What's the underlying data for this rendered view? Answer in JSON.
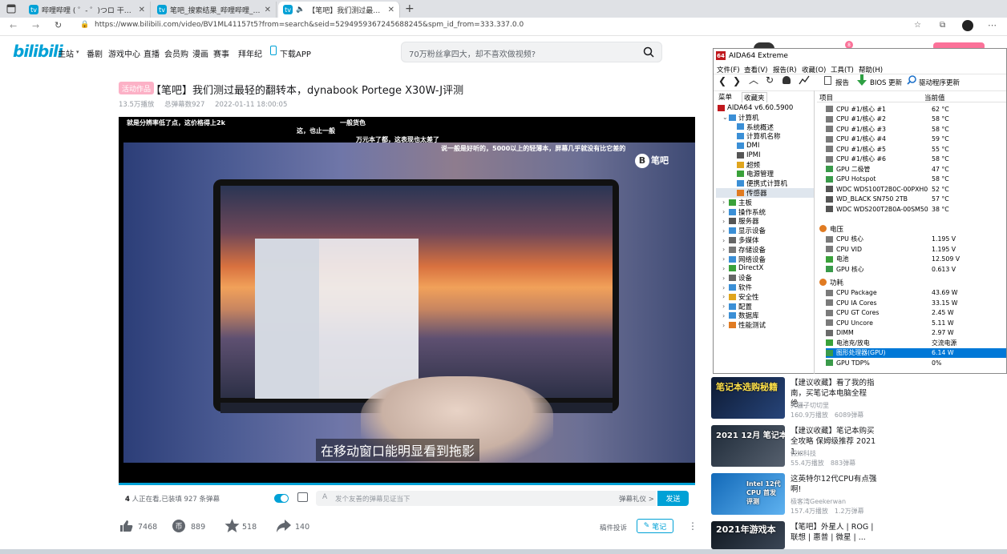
{
  "browser": {
    "tabs": [
      {
        "label": "哔哩哔哩 ( ゜- ゜)つロ 干杯~-bilil",
        "active": false
      },
      {
        "label": "笔吧_搜索结果_哔哩哔哩_Bilibili",
        "active": false
      },
      {
        "label": "【笔吧】我们测过最轻的翻",
        "active": true
      }
    ],
    "new_tab": "+",
    "url": "https://www.bilibili.com/video/BV1ML41157t5?from=search&seid=5294959367245688245&spm_id_from=333.337.0.0"
  },
  "bili_header": {
    "logo": "bilibili",
    "nav": [
      "主站",
      "番剧",
      "游戏中心",
      "直播",
      "会员购",
      "漫画",
      "赛事",
      "拜年纪",
      "下载APP"
    ],
    "search_placeholder": "70万粉丝拿四大，却不喜欢做视频?",
    "login_badge": "8"
  },
  "video": {
    "tag": "活动作品",
    "title": "【笔吧】我们测过最轻的翻转本，dynabook Portege X30W-J评测",
    "plays": "13.5万播放",
    "danmaku_total": "总弹幕数927",
    "date": "2022-01-11 18:00:05",
    "overlay_texts": [
      "就是分辨率低了点，这价格得上2k",
      "一般货色",
      "这，也止一般",
      "万元本了都，这表现也太差了",
      "说一般是好听的，5000以上的轻薄本，屏幕几乎就没有比它差的"
    ],
    "watermark": "笔吧",
    "subtitle": "在移动窗口能明显看到拖影"
  },
  "danmaku_bar": {
    "viewers_count": "4",
    "viewers_text": "人正在看,已装填 927 条弹幕",
    "input_placeholder": "发个友善的弹幕见证当下",
    "etiquette": "弹幕礼仪 >",
    "send": "发送"
  },
  "actions": {
    "like": "7468",
    "coin": "889",
    "favorite": "518",
    "share": "140",
    "complain": "稿件投诉",
    "note": "笔记"
  },
  "recommendations": [
    {
      "title": "【建议收藏】看了我的指南，买笔记本电脑全程绝...",
      "owner": "大疆子切切里",
      "plays": "160.9万播放",
      "danmaku": "6089弹幕",
      "thumb_text": "笔记本选购秘籍"
    },
    {
      "title": "【建议收藏】笔记本购买全攻略 保姆级推荐 2021 1...",
      "owner": "假如科技",
      "plays": "55.4万播放",
      "danmaku": "883弹幕",
      "thumb_text": "2021 12月 笔记本推荐"
    },
    {
      "title": "这英特尔12代CPU有点强啊!",
      "owner": "极客湾Geekerwan",
      "plays": "157.4万播放",
      "danmaku": "1.2万弹幕",
      "thumb_text": "Intel 12代CPU 首发评测"
    },
    {
      "title": "【笔吧】外星人 | ROG | 联想 | 惠普 | 微星 | ...",
      "owner": "",
      "plays": "",
      "danmaku": "",
      "thumb_text": "2021年游戏本"
    }
  ],
  "aida": {
    "title": "AIDA64 Extreme",
    "logo": "64",
    "menu": [
      "文件(F)",
      "查看(V)",
      "报告(R)",
      "收藏(O)",
      "工具(T)",
      "帮助(H)"
    ],
    "toolbar": {
      "report": "报告",
      "bios": "BIOS 更新",
      "driver": "驱动程序更新"
    },
    "pane_tabs": [
      "菜单",
      "收藏夹"
    ],
    "tree": [
      {
        "label": "AIDA64 v6.60.5900",
        "level": 0,
        "icon": "#c0181d"
      },
      {
        "label": "计算机",
        "level": 1,
        "icon": "#3b8fd6",
        "open": true
      },
      {
        "label": "系统概述",
        "level": 2,
        "icon": "#3b8fd6"
      },
      {
        "label": "计算机名称",
        "level": 2,
        "icon": "#3b8fd6"
      },
      {
        "label": "DMI",
        "level": 2,
        "icon": "#3b8fd6"
      },
      {
        "label": "IPMI",
        "level": 2,
        "icon": "#555555"
      },
      {
        "label": "超频",
        "level": 2,
        "icon": "#e0a51e"
      },
      {
        "label": "电源管理",
        "level": 2,
        "icon": "#3aa13a"
      },
      {
        "label": "便携式计算机",
        "level": 2,
        "icon": "#3b8fd6"
      },
      {
        "label": "传感器",
        "level": 2,
        "icon": "#e07b22",
        "selected": true
      },
      {
        "label": "主板",
        "level": 1,
        "icon": "#3aa13a"
      },
      {
        "label": "操作系统",
        "level": 1,
        "icon": "#3b8fd6"
      },
      {
        "label": "服务器",
        "level": 1,
        "icon": "#555555"
      },
      {
        "label": "显示设备",
        "level": 1,
        "icon": "#3b8fd6"
      },
      {
        "label": "多媒体",
        "level": 1,
        "icon": "#666666"
      },
      {
        "label": "存储设备",
        "level": 1,
        "icon": "#777777"
      },
      {
        "label": "网络设备",
        "level": 1,
        "icon": "#3b8fd6"
      },
      {
        "label": "DirectX",
        "level": 1,
        "icon": "#3aa13a"
      },
      {
        "label": "设备",
        "level": 1,
        "icon": "#666666"
      },
      {
        "label": "软件",
        "level": 1,
        "icon": "#3b8fd6"
      },
      {
        "label": "安全性",
        "level": 1,
        "icon": "#e0a51e"
      },
      {
        "label": "配置",
        "level": 1,
        "icon": "#3b8fd6"
      },
      {
        "label": "数据库",
        "level": 1,
        "icon": "#3b8fd6"
      },
      {
        "label": "性能测试",
        "level": 1,
        "icon": "#e07b22"
      }
    ],
    "columns": [
      "项目",
      "当前值"
    ],
    "temperature": [
      {
        "name": "CPU #1/核心 #1",
        "value": "62 °C"
      },
      {
        "name": "CPU #1/核心 #2",
        "value": "58 °C"
      },
      {
        "name": "CPU #1/核心 #3",
        "value": "58 °C"
      },
      {
        "name": "CPU #1/核心 #4",
        "value": "59 °C"
      },
      {
        "name": "CPU #1/核心 #5",
        "value": "55 °C"
      },
      {
        "name": "CPU #1/核心 #6",
        "value": "58 °C"
      },
      {
        "name": "GPU 二极管",
        "value": "47 °C"
      },
      {
        "name": "GPU Hotspot",
        "value": "58 °C"
      },
      {
        "name": "WDC WDS100T2B0C-00PXH0",
        "value": "52 °C"
      },
      {
        "name": "WD_BLACK SN750 2TB",
        "value": "57 °C"
      },
      {
        "name": "WDC WDS200T2B0A-00SM50",
        "value": "38 °C"
      }
    ],
    "voltage_title": "电压",
    "voltage": [
      {
        "name": "CPU 核心",
        "value": "1.195 V"
      },
      {
        "name": "CPU VID",
        "value": "1.195 V"
      },
      {
        "name": "电池",
        "value": "12.509 V"
      },
      {
        "name": "GPU 核心",
        "value": "0.613 V"
      }
    ],
    "power_title": "功耗",
    "power": [
      {
        "name": "CPU Package",
        "value": "43.69 W"
      },
      {
        "name": "CPU IA Cores",
        "value": "33.15 W"
      },
      {
        "name": "CPU GT Cores",
        "value": "2.45 W"
      },
      {
        "name": "CPU Uncore",
        "value": "5.11 W"
      },
      {
        "name": "DIMM",
        "value": "2.97 W"
      },
      {
        "name": "电池充/放电",
        "value": "交流电源"
      },
      {
        "name": "图形处理器(GPU)",
        "value": "6.14 W",
        "selected": true
      },
      {
        "name": "GPU TDP%",
        "value": "0%"
      }
    ]
  }
}
